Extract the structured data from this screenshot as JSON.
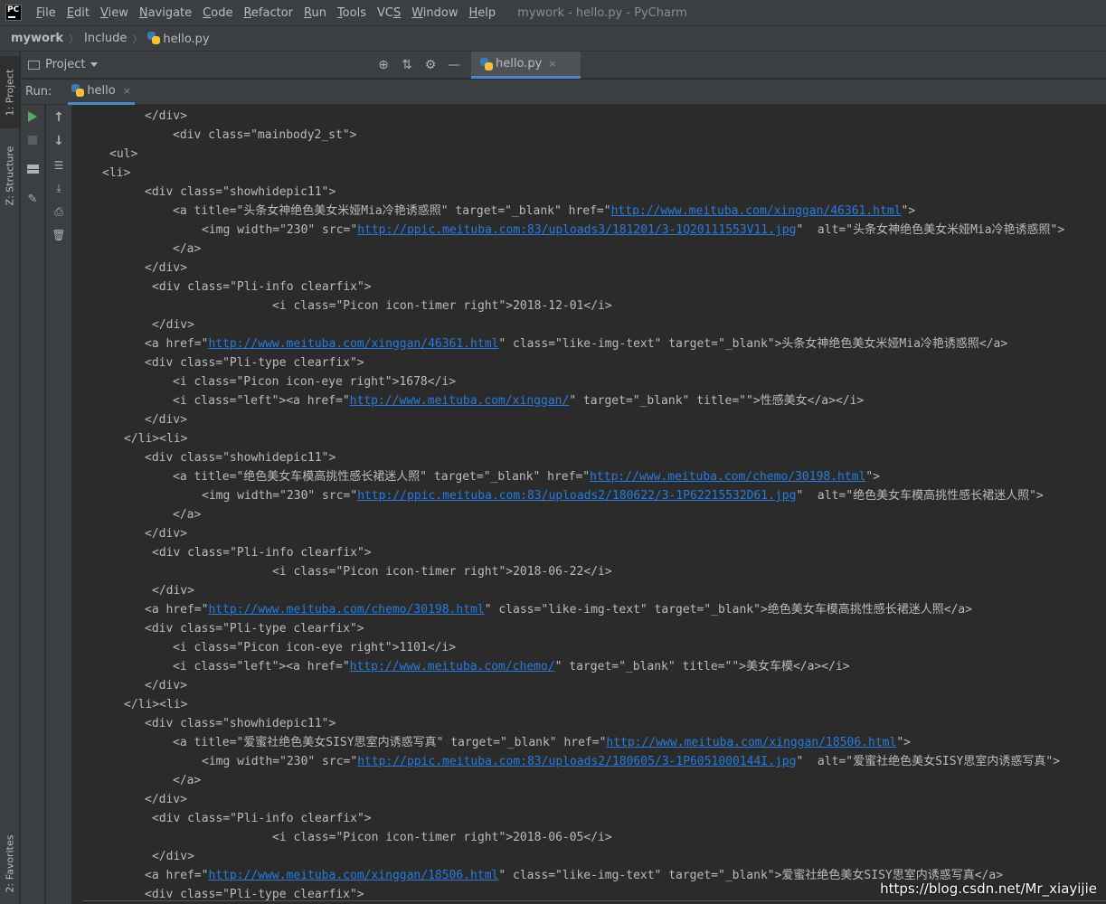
{
  "app": {
    "logo_text": "PC",
    "window_title": "mywork - hello.py - PyCharm"
  },
  "menu": [
    {
      "label": "File",
      "mnemonic": "F",
      "rest": "ile"
    },
    {
      "label": "Edit",
      "mnemonic": "E",
      "rest": "dit"
    },
    {
      "label": "View",
      "mnemonic": "V",
      "rest": "iew"
    },
    {
      "label": "Navigate",
      "mnemonic": "N",
      "rest": "avigate"
    },
    {
      "label": "Code",
      "mnemonic": "C",
      "rest": "ode"
    },
    {
      "label": "Refactor",
      "mnemonic": "R",
      "rest": "efactor"
    },
    {
      "label": "Run",
      "mnemonic": "R",
      "rest": "un"
    },
    {
      "label": "Tools",
      "mnemonic": "T",
      "rest": "ools"
    },
    {
      "label": "VCS",
      "mnemonic": "S",
      "rest": "VC"
    },
    {
      "label": "Window",
      "mnemonic": "W",
      "rest": "indow"
    },
    {
      "label": "Help",
      "mnemonic": "H",
      "rest": "elp"
    }
  ],
  "breadcrumb": [
    "mywork",
    "Include",
    "hello.py"
  ],
  "left_tabs": {
    "project": "1: Project",
    "structure": "Z: Structure",
    "favorites": "2: Favorites"
  },
  "project_panel": {
    "label": "Project"
  },
  "editor_tab": {
    "label": "hello.py",
    "close": "×"
  },
  "run": {
    "label": "Run:",
    "tab_label": "hello",
    "close": "×"
  },
  "console_lines": [
    {
      "indent": 13,
      "parts": [
        {
          "t": "</div>"
        }
      ]
    },
    {
      "indent": 17,
      "parts": [
        {
          "t": "<div class=\"mainbody2_st\">"
        }
      ]
    },
    {
      "indent": 8,
      "parts": [
        {
          "t": "<ul>"
        }
      ]
    },
    {
      "indent": 7,
      "parts": [
        {
          "t": "<li>"
        }
      ]
    },
    {
      "indent": 13,
      "parts": [
        {
          "t": "<div class=\"showhidepic11\">"
        }
      ]
    },
    {
      "indent": 17,
      "parts": [
        {
          "t": "<a title=\"头条女神绝色美女米娅Mia冷艳诱惑照\" target=\"_blank\" href=\""
        },
        {
          "t": "http://www.meituba.com/xinggan/46361.html",
          "link": true
        },
        {
          "t": "\">"
        }
      ]
    },
    {
      "indent": 21,
      "parts": [
        {
          "t": "<img width=\"230\" src=\""
        },
        {
          "t": "http://ppic.meituba.com:83/uploads3/181201/3-1Q20111553V11.jpg",
          "link": true
        },
        {
          "t": "\"  alt=\"头条女神绝色美女米娅Mia冷艳诱惑照\">"
        }
      ]
    },
    {
      "indent": 17,
      "parts": [
        {
          "t": "</a>"
        }
      ]
    },
    {
      "indent": 13,
      "parts": [
        {
          "t": "</div>"
        }
      ]
    },
    {
      "indent": 14,
      "parts": [
        {
          "t": "<div class=\"Pli-info clearfix\">"
        }
      ]
    },
    {
      "indent": 31,
      "parts": [
        {
          "t": "<i class=\"Picon icon-timer right\">2018-12-01</i>"
        }
      ]
    },
    {
      "indent": 14,
      "parts": [
        {
          "t": "</div>"
        }
      ]
    },
    {
      "indent": 13,
      "parts": [
        {
          "t": "<a href=\""
        },
        {
          "t": "http://www.meituba.com/xinggan/46361.html",
          "link": true
        },
        {
          "t": "\" class=\"like-img-text\" target=\"_blank\">头条女神绝色美女米娅Mia冷艳诱惑照</a>"
        }
      ]
    },
    {
      "indent": 13,
      "parts": [
        {
          "t": "<div class=\"Pli-type clearfix\">"
        }
      ]
    },
    {
      "indent": 17,
      "parts": [
        {
          "t": "<i class=\"Picon icon-eye right\">1678</i>"
        }
      ]
    },
    {
      "indent": 17,
      "parts": [
        {
          "t": "<i class=\"left\"><a href=\""
        },
        {
          "t": "http://www.meituba.com/xinggan/",
          "link": true
        },
        {
          "t": "\" target=\"_blank\" title=\"\">性感美女</a></i>"
        }
      ]
    },
    {
      "indent": 13,
      "parts": [
        {
          "t": "</div>"
        }
      ]
    },
    {
      "indent": 10,
      "parts": [
        {
          "t": "</li><li>"
        }
      ]
    },
    {
      "indent": 13,
      "parts": [
        {
          "t": "<div class=\"showhidepic11\">"
        }
      ]
    },
    {
      "indent": 17,
      "parts": [
        {
          "t": "<a title=\"绝色美女车模高挑性感长裙迷人照\" target=\"_blank\" href=\""
        },
        {
          "t": "http://www.meituba.com/chemo/30198.html",
          "link": true
        },
        {
          "t": "\">"
        }
      ]
    },
    {
      "indent": 21,
      "parts": [
        {
          "t": "<img width=\"230\" src=\""
        },
        {
          "t": "http://ppic.meituba.com:83/uploads2/180622/3-1P62215532D61.jpg",
          "link": true
        },
        {
          "t": "\"  alt=\"绝色美女车模高挑性感长裙迷人照\">"
        }
      ]
    },
    {
      "indent": 17,
      "parts": [
        {
          "t": "</a>"
        }
      ]
    },
    {
      "indent": 13,
      "parts": [
        {
          "t": "</div>"
        }
      ]
    },
    {
      "indent": 14,
      "parts": [
        {
          "t": "<div class=\"Pli-info clearfix\">"
        }
      ]
    },
    {
      "indent": 31,
      "parts": [
        {
          "t": "<i class=\"Picon icon-timer right\">2018-06-22</i>"
        }
      ]
    },
    {
      "indent": 14,
      "parts": [
        {
          "t": "</div>"
        }
      ]
    },
    {
      "indent": 13,
      "parts": [
        {
          "t": "<a href=\""
        },
        {
          "t": "http://www.meituba.com/chemo/30198.html",
          "link": true
        },
        {
          "t": "\" class=\"like-img-text\" target=\"_blank\">绝色美女车模高挑性感长裙迷人照</a>"
        }
      ]
    },
    {
      "indent": 13,
      "parts": [
        {
          "t": "<div class=\"Pli-type clearfix\">"
        }
      ]
    },
    {
      "indent": 17,
      "parts": [
        {
          "t": "<i class=\"Picon icon-eye right\">1101</i>"
        }
      ]
    },
    {
      "indent": 17,
      "parts": [
        {
          "t": "<i class=\"left\"><a href=\""
        },
        {
          "t": "http://www.meituba.com/chemo/",
          "link": true
        },
        {
          "t": "\" target=\"_blank\" title=\"\">美女车模</a></i>"
        }
      ]
    },
    {
      "indent": 13,
      "parts": [
        {
          "t": "</div>"
        }
      ]
    },
    {
      "indent": 10,
      "parts": [
        {
          "t": "</li><li>"
        }
      ]
    },
    {
      "indent": 13,
      "parts": [
        {
          "t": "<div class=\"showhidepic11\">"
        }
      ]
    },
    {
      "indent": 17,
      "parts": [
        {
          "t": "<a title=\"爱蜜社绝色美女SISY思室内诱惑写真\" target=\"_blank\" href=\""
        },
        {
          "t": "http://www.meituba.com/xinggan/18506.html",
          "link": true
        },
        {
          "t": "\">"
        }
      ]
    },
    {
      "indent": 21,
      "parts": [
        {
          "t": "<img width=\"230\" src=\""
        },
        {
          "t": "http://ppic.meituba.com:83/uploads2/180605/3-1P6051000144I.jpg",
          "link": true
        },
        {
          "t": "\"  alt=\"爱蜜社绝色美女SISY思室内诱惑写真\">"
        }
      ]
    },
    {
      "indent": 17,
      "parts": [
        {
          "t": "</a>"
        }
      ]
    },
    {
      "indent": 13,
      "parts": [
        {
          "t": "</div>"
        }
      ]
    },
    {
      "indent": 14,
      "parts": [
        {
          "t": "<div class=\"Pli-info clearfix\">"
        }
      ]
    },
    {
      "indent": 31,
      "parts": [
        {
          "t": "<i class=\"Picon icon-timer right\">2018-06-05</i>"
        }
      ]
    },
    {
      "indent": 14,
      "parts": [
        {
          "t": "</div>"
        }
      ]
    },
    {
      "indent": 13,
      "parts": [
        {
          "t": "<a href=\""
        },
        {
          "t": "http://www.meituba.com/xinggan/18506.html",
          "link": true
        },
        {
          "t": "\" class=\"like-img-text\" target=\"_blank\">爱蜜社绝色美女SISY思室内诱惑写真</a>"
        }
      ]
    },
    {
      "indent": 13,
      "parts": [
        {
          "t": "<div class=\"Pli-type clearfix\">"
        }
      ]
    }
  ],
  "watermark": "https://blog.csdn.net/Mr_xiayijie",
  "colors": {
    "background": "#2b2b2b",
    "panel": "#3c3f41",
    "text": "#bbbbbb",
    "link": "#287bde",
    "accent": "#4a88c7",
    "run_green": "#59a869"
  }
}
